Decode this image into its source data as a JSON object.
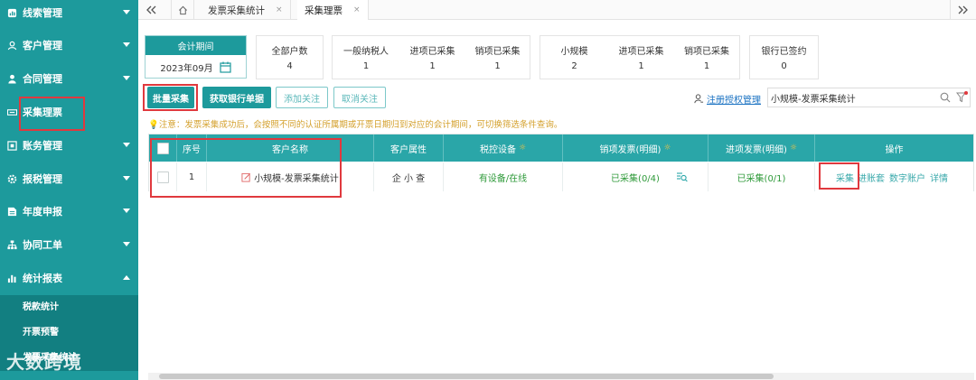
{
  "sidebar": {
    "items": [
      {
        "icon": "chart-icon",
        "label": "线索管理"
      },
      {
        "icon": "people-icon",
        "label": "客户管理"
      },
      {
        "icon": "person-icon",
        "label": "合同管理"
      },
      {
        "icon": "invoice-icon",
        "label": "采集理票"
      },
      {
        "icon": "building-icon",
        "label": "账务管理"
      },
      {
        "icon": "gear-icon",
        "label": "报税管理"
      },
      {
        "icon": "report-icon",
        "label": "年度申报"
      },
      {
        "icon": "org-icon",
        "label": "协同工单"
      },
      {
        "icon": "bar-chart-icon",
        "label": "统计报表"
      }
    ],
    "subitems": [
      {
        "label": "税款统计"
      },
      {
        "label": "开票预警"
      },
      {
        "label": "发票采集统计"
      }
    ],
    "watermark": "大数跨境"
  },
  "tabbar": {
    "tabs": [
      {
        "label": "发票采集统计",
        "close": "×"
      },
      {
        "label": "采集理票",
        "close": "×"
      }
    ]
  },
  "period": {
    "title": "会计期间",
    "value": "2023年09月"
  },
  "stats": [
    {
      "label": "全部户数",
      "value": "4"
    },
    {
      "label": "一般纳税人",
      "value": "1"
    },
    {
      "label": "进项已采集",
      "value": "1"
    },
    {
      "label": "销项已采集",
      "value": "1"
    },
    {
      "label": "小规模",
      "value": "2"
    },
    {
      "label": "进项已采集",
      "value": "1"
    },
    {
      "label": "销项已采集",
      "value": "1"
    },
    {
      "label": "银行已签约",
      "value": "0"
    }
  ],
  "toolbar": {
    "batch_collect": "批量采集",
    "get_bank_statement": "获取银行单据",
    "add_follow": "添加关注",
    "cancel_follow": "取消关注",
    "register_auth": "注册授权管理",
    "search_value": "小规模-发票采集统计"
  },
  "notice": "注意：发票采集成功后，会按照不同的认证所属期或开票日期归到对应的会计期间，可切换筛选条件查询。",
  "table": {
    "headers": {
      "seq": "序号",
      "name": "客户名称",
      "attr": "客户属性",
      "device": "税控设备",
      "sales": "销项发票(明细)",
      "input": "进项发票(明细)",
      "ops": "操作"
    },
    "rows": [
      {
        "seq": "1",
        "name": "小规模-发票采集统计",
        "attr": "企 小 查",
        "device": "有设备/在线",
        "sales": "已采集(0/4)",
        "input": "已采集(0/1)",
        "ops": {
          "collect": "采集",
          "ledger": "进账套",
          "digital": "数字账户",
          "detail": "详情"
        }
      }
    ]
  },
  "colors": {
    "teal": "#1d9a9c",
    "teal_dark": "#127f81",
    "header": "#2aa6a8",
    "green_text": "#2f9a3a",
    "red_box": "#e0393e"
  }
}
